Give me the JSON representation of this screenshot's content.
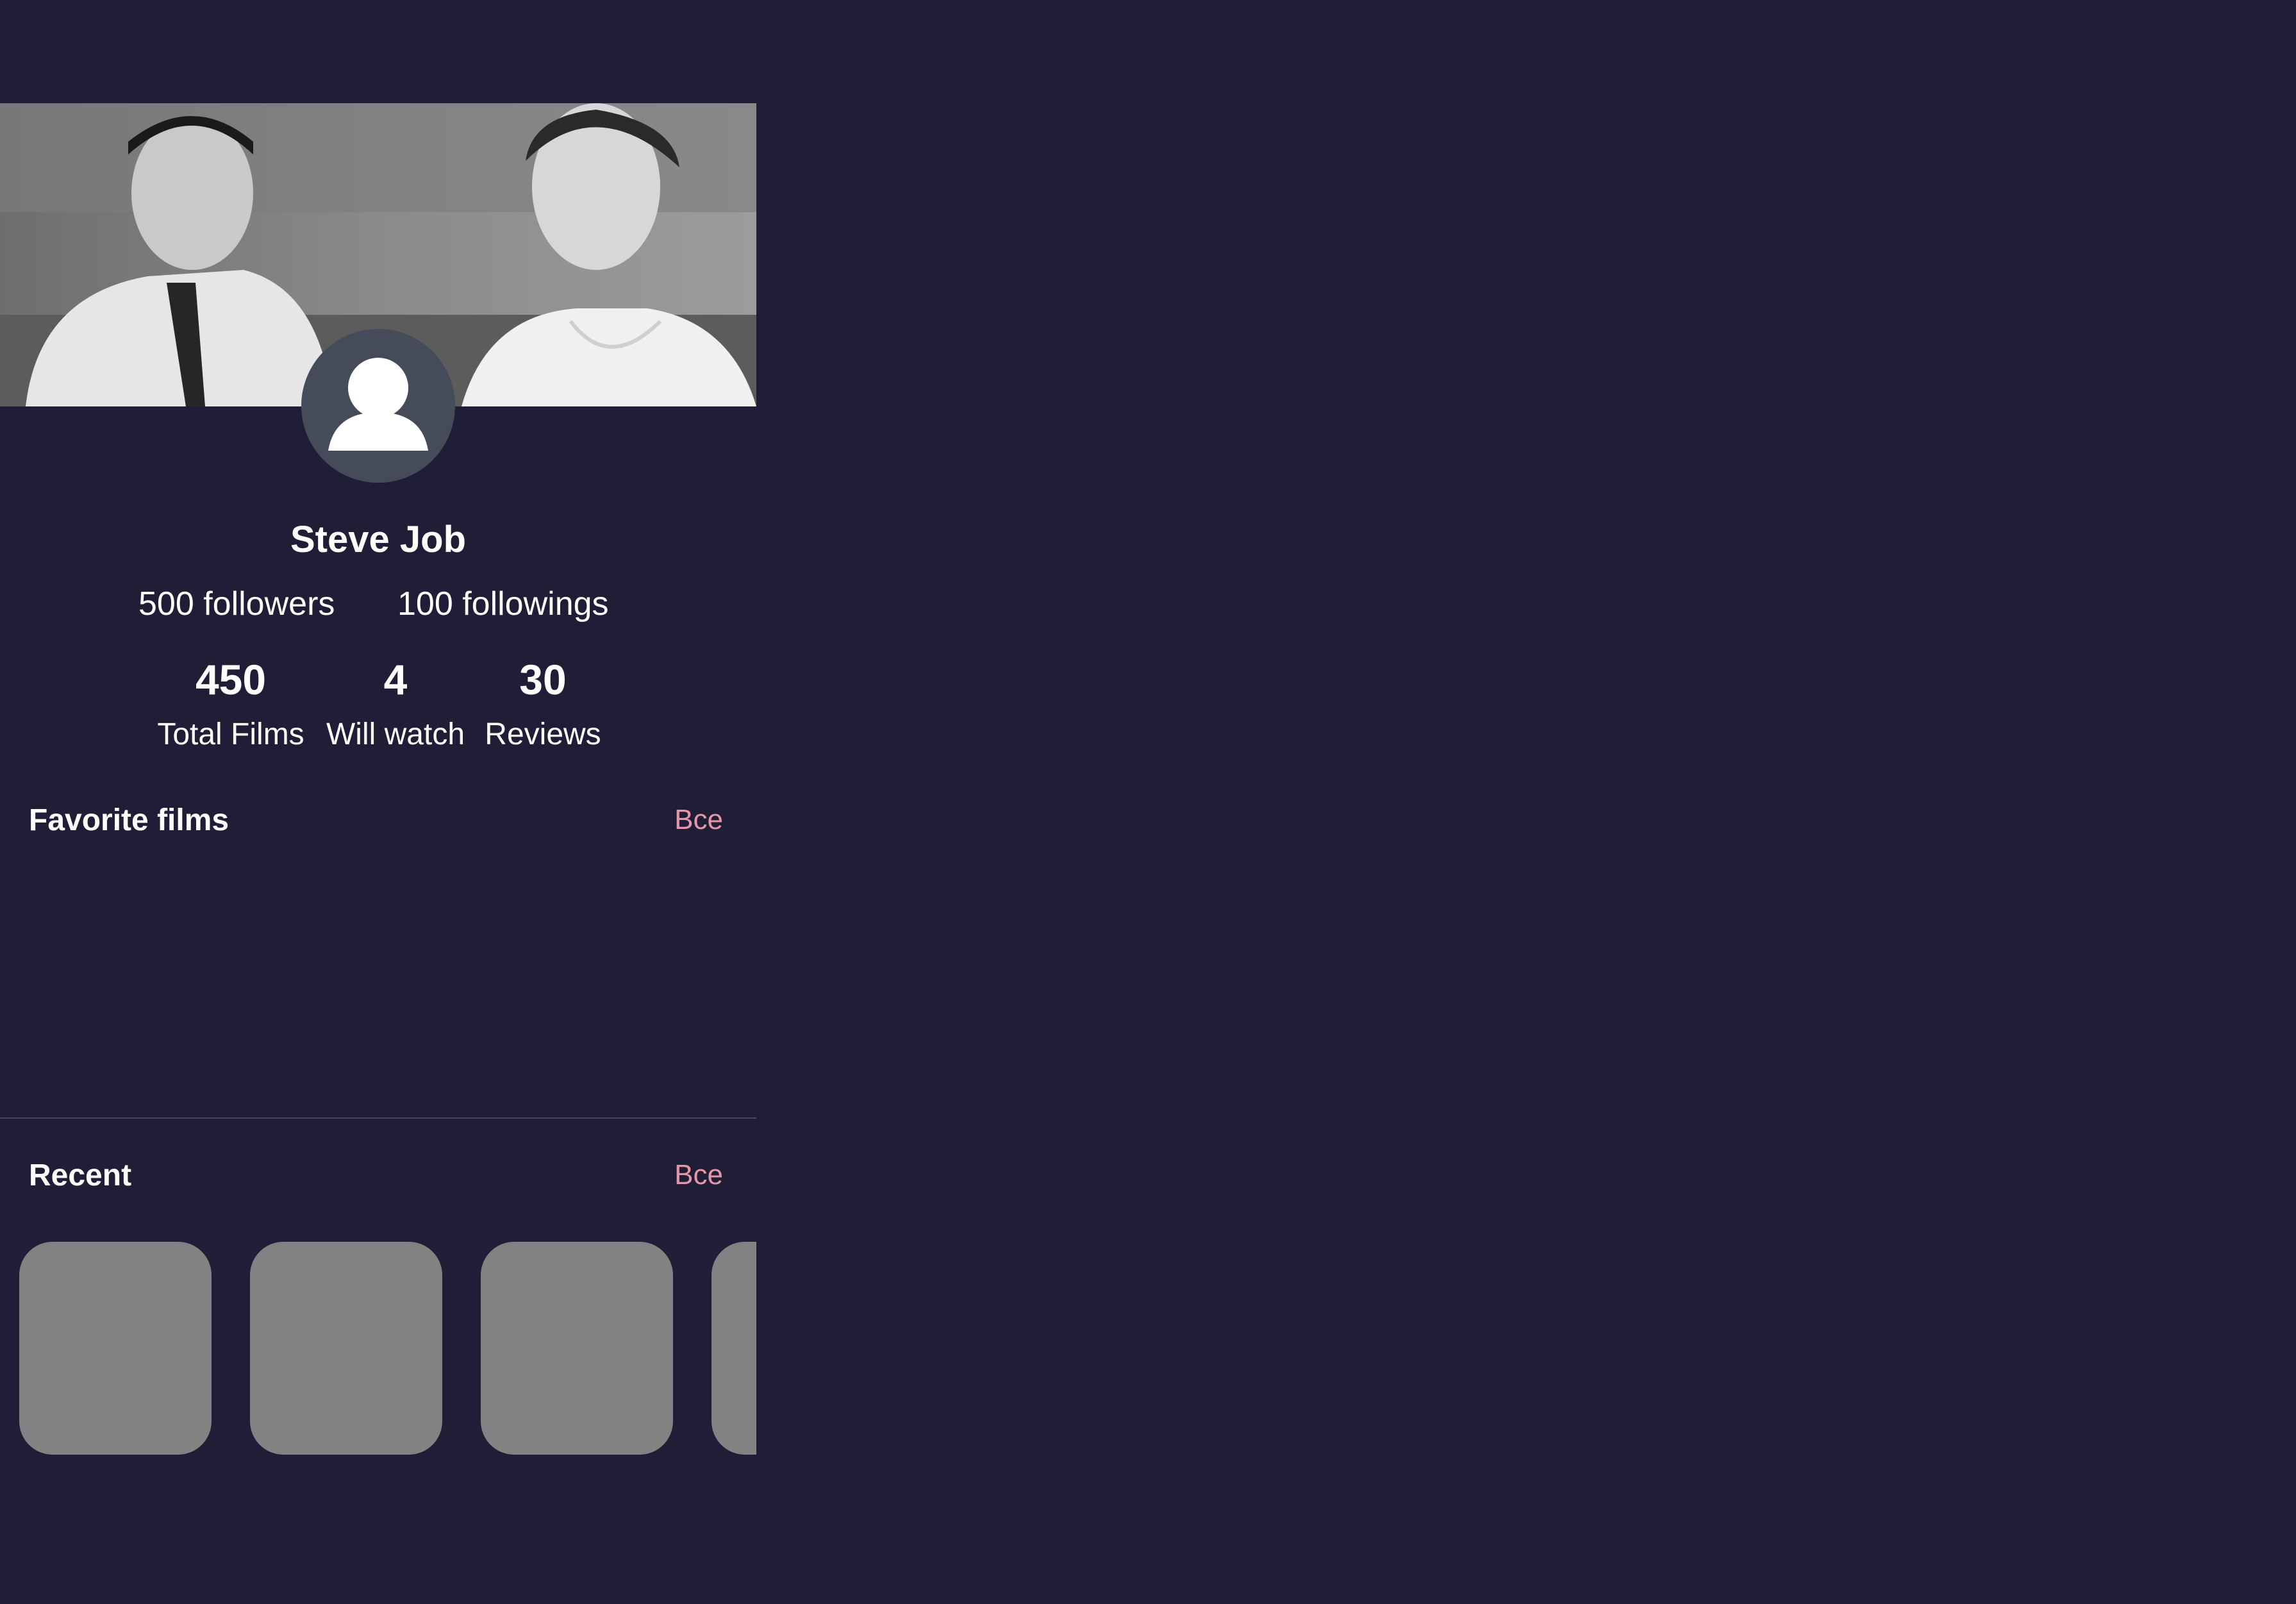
{
  "profile": {
    "name": "Steve Job",
    "followers": "500 followers",
    "followings": "100 followings"
  },
  "stats": [
    {
      "value": "450",
      "label": "Total Films"
    },
    {
      "value": "4",
      "label": "Will watch"
    },
    {
      "value": "30",
      "label": "Reviews"
    }
  ],
  "favorites": {
    "title": "Favorite films",
    "see_all": "Все"
  },
  "recent": {
    "title": "Recent",
    "see_all": "Все",
    "items": 4
  },
  "icons": {
    "avatar": "person-icon"
  },
  "colors": {
    "background": "#201e37",
    "accent": "#e497a8",
    "avatar_bg": "#454b58",
    "placeholder": "#828282"
  }
}
